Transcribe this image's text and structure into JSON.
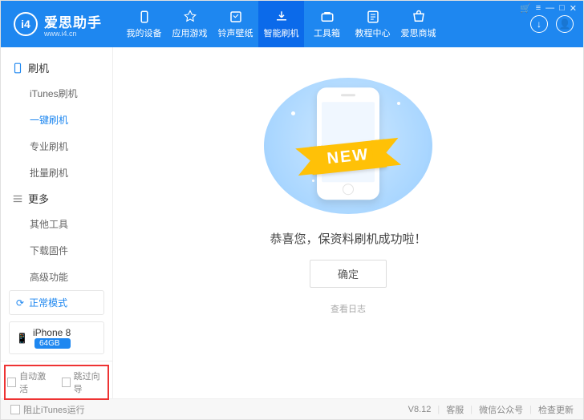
{
  "brand": {
    "name": "爱思助手",
    "url": "www.i4.cn",
    "logo_text": "i4"
  },
  "window_controls": {
    "cart": "🛒",
    "menu": "≡",
    "min": "—",
    "max": "□",
    "close": "✕"
  },
  "header_tabs": [
    {
      "label": "我的设备"
    },
    {
      "label": "应用游戏"
    },
    {
      "label": "铃声壁纸"
    },
    {
      "label": "智能刷机",
      "active": true
    },
    {
      "label": "工具箱"
    },
    {
      "label": "教程中心"
    },
    {
      "label": "爱思商城"
    }
  ],
  "header_right": {
    "download": "↓",
    "user": "👤"
  },
  "sidebar": {
    "section1": {
      "title": "刷机",
      "items": [
        {
          "label": "iTunes刷机"
        },
        {
          "label": "一键刷机",
          "active": true
        },
        {
          "label": "专业刷机"
        },
        {
          "label": "批量刷机"
        }
      ]
    },
    "section2": {
      "title": "更多",
      "items": [
        {
          "label": "其他工具"
        },
        {
          "label": "下载固件"
        },
        {
          "label": "高级功能"
        }
      ]
    },
    "mode": "正常模式",
    "device": {
      "name": "iPhone 8",
      "storage": "64GB"
    },
    "checks": {
      "auto_activate": "自动激活",
      "skip_setup": "跳过向导"
    }
  },
  "main": {
    "ribbon": "NEW",
    "message": "恭喜您，保资料刷机成功啦！",
    "confirm": "确定",
    "view_log": "查看日志"
  },
  "footer": {
    "block_itunes": "阻止iTunes运行",
    "version": "V8.12",
    "kefu": "客服",
    "wechat": "微信公众号",
    "update": "检查更新"
  }
}
